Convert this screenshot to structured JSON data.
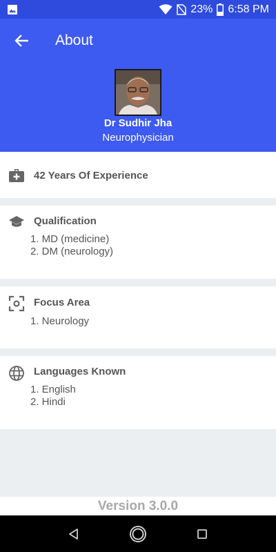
{
  "status_bar": {
    "battery_percent": "23%",
    "time": "6:58 PM",
    "icons": [
      "image-icon",
      "wifi-icon",
      "no-sim-icon",
      "battery-icon"
    ]
  },
  "app_bar": {
    "title": "About",
    "back_icon": "arrow-back-icon"
  },
  "profile": {
    "name": "Dr Sudhir Jha",
    "specialty": "Neurophysician"
  },
  "experience": {
    "label": "42 Years Of Experience",
    "icon": "medical-bag-icon"
  },
  "qualification": {
    "heading": "Qualification",
    "icon": "graduation-cap-icon",
    "items": [
      "1. MD (medicine)",
      "2. DM (neurology)"
    ]
  },
  "focus": {
    "heading": "Focus Area",
    "icon": "center-focus-icon",
    "items": [
      "1. Neurology"
    ]
  },
  "languages": {
    "heading": "Languages Known",
    "icon": "globe-icon",
    "items": [
      "1. English",
      "2. Hindi"
    ]
  },
  "footer": {
    "version": "Version 3.0.0"
  },
  "colors": {
    "primary": "#3d5af1",
    "status_bar": "#2f4bde",
    "background": "#eceff2",
    "text": "#555555",
    "version_text": "#a8a8a8"
  }
}
